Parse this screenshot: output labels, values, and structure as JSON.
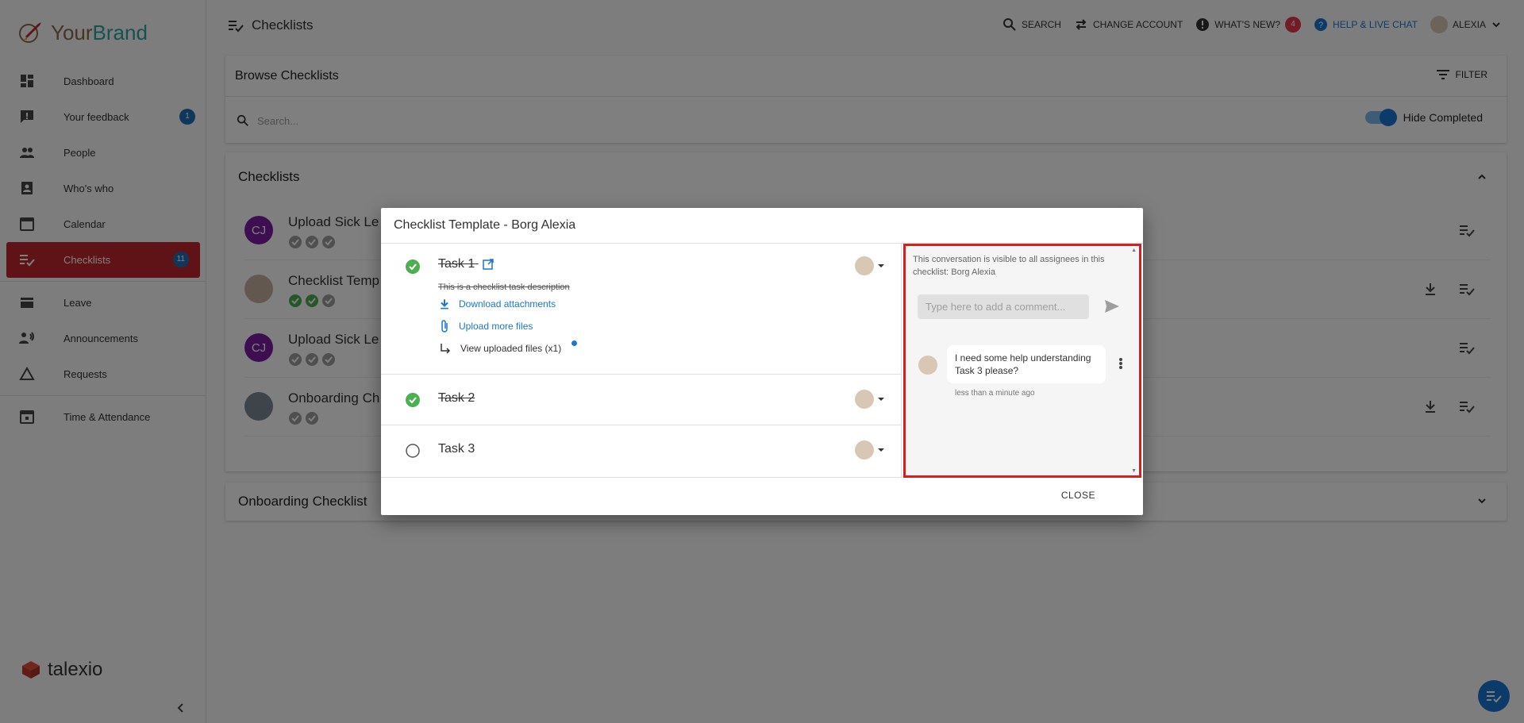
{
  "brand": {
    "part1": "Your",
    "part2": "Brand"
  },
  "sidebar": {
    "items": [
      {
        "label": "Dashboard",
        "icon": "dashboard-icon"
      },
      {
        "label": "Your feedback",
        "icon": "feedback-icon",
        "badge": "1"
      },
      {
        "label": "People",
        "icon": "people-icon"
      },
      {
        "label": "Who's who",
        "icon": "contact-card-icon"
      },
      {
        "label": "Calendar",
        "icon": "calendar-icon"
      },
      {
        "label": "Checklists",
        "icon": "checklist-icon",
        "badge": "11",
        "active": true
      },
      {
        "label": "Leave",
        "icon": "leave-icon"
      },
      {
        "label": "Announcements",
        "icon": "megaphone-icon"
      },
      {
        "label": "Requests",
        "icon": "triangle-icon"
      },
      {
        "label": "Time & Attendance",
        "icon": "calendar-clock-icon"
      }
    ],
    "footer_brand": "talexio"
  },
  "header": {
    "title": "Checklists",
    "search": "SEARCH",
    "change_account": "CHANGE ACCOUNT",
    "whats_new": "WHAT'S NEW?",
    "whats_new_count": "4",
    "help": "HELP & LIVE CHAT",
    "user": "ALEXIA"
  },
  "browse": {
    "title": "Browse Checklists",
    "filter": "FILTER",
    "search_placeholder": "Search...",
    "hide_completed": "Hide Completed",
    "hide_completed_on": true
  },
  "checklists": {
    "title": "Checklists",
    "rows": [
      {
        "initials": "CJ",
        "title": "Upload Sick Le",
        "checks": [
          "grey",
          "grey",
          "grey"
        ]
      },
      {
        "initials": "",
        "title": "Checklist Temp",
        "checks": [
          "green",
          "green",
          "grey"
        ]
      },
      {
        "initials": "CJ",
        "title": "Upload Sick Le",
        "checks": [
          "grey",
          "grey",
          "grey"
        ]
      },
      {
        "initials": "",
        "title": "Onboarding Ch",
        "checks": [
          "grey",
          "grey"
        ]
      }
    ]
  },
  "onboarding": {
    "title": "Onboarding Checklist"
  },
  "modal": {
    "title": "Checklist Template - Borg Alexia",
    "tasks": [
      {
        "name": "Task 1",
        "done": true,
        "description": "This is a checklist task description",
        "download": "Download attachments",
        "upload": "Upload more files",
        "view": "View uploaded files (x1)"
      },
      {
        "name": "Task 2",
        "done": true
      },
      {
        "name": "Task 3",
        "done": false
      }
    ],
    "chat": {
      "note": "This conversation is visible to all assignees in this checklist: Borg Alexia",
      "input_placeholder": "Type here to add a comment...",
      "message": "I need some help understanding Task 3 please?",
      "time": "less than a minute ago"
    },
    "close": "CLOSE"
  },
  "colors": {
    "accent": "#1976d2",
    "active_nav": "#c1272d",
    "success": "#4caf50",
    "highlight_border": "#d62020"
  }
}
